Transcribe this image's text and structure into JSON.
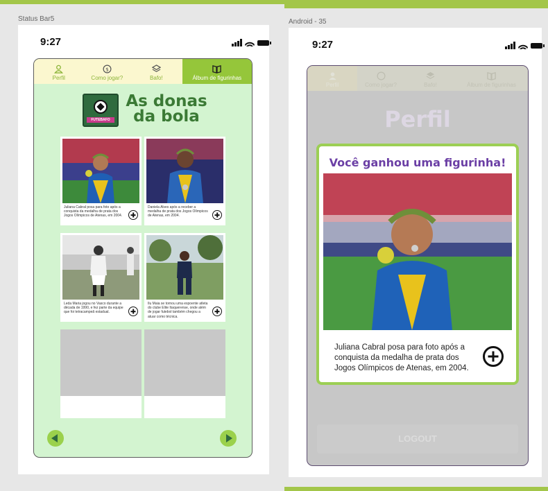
{
  "artboards": {
    "left_label": "Status Bar5",
    "right_label": "Android - 35"
  },
  "status_bar": {
    "time": "9:27"
  },
  "tabs": [
    {
      "label": "Perfil",
      "icon": "user-icon"
    },
    {
      "label": "Como jogar?",
      "icon": "question-icon"
    },
    {
      "label": "Bafo!",
      "icon": "layers-icon"
    },
    {
      "label": "Álbum de figurinhas",
      "icon": "book-icon"
    }
  ],
  "album": {
    "title_line1": "As donas",
    "title_line2": "da bola",
    "logo_text": "FUTEBAFO",
    "cards": [
      {
        "caption": "Juliana Cabral posa para foto após a conquista da medalha de prata dos Jogos Olímpicos de Atenas, em 2004."
      },
      {
        "caption": "Daniela Alves após a receber a medalha de prata dos Jogos Olímpicos de Atenas, em 2004."
      },
      {
        "caption": "Leda Maria jogou no Vasco durante a década de 1990, e fez parte da equipe que foi tetracampeã estadual."
      },
      {
        "caption": "Ilu Maia se tornou uma expoente atleta do clube Elite Itaquerense, onde além de jogar futebol também chegou a atuar como técnica."
      }
    ]
  },
  "profile": {
    "heading": "Perfil",
    "logout_label": "LOGOUT"
  },
  "modal": {
    "title": "Você ganhou uma figurinha!",
    "caption": "Juliana Cabral posa para foto após a conquista da medalha de prata dos Jogos Olímpicos de Atenas, em 2004."
  },
  "colors": {
    "brand_green": "#95c63a",
    "album_bg": "#d3f4d0",
    "title_green": "#3b7a35",
    "modal_purple": "#6b3fa5"
  }
}
